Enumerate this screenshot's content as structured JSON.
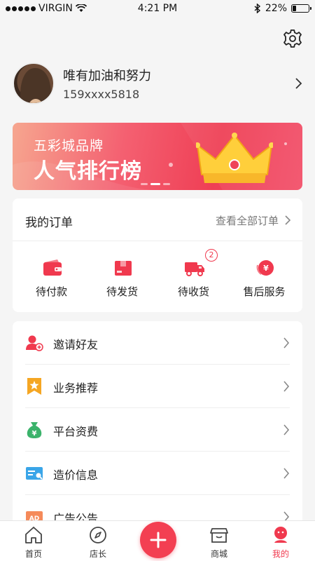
{
  "status_bar": {
    "carrier": "VIRGIN",
    "time": "4:21 PM",
    "battery": "22%",
    "battery_level": 0.22
  },
  "profile": {
    "name": "唯有加油和努力",
    "phone": "159xxxx5818"
  },
  "banner": {
    "subtitle": "五彩城品牌",
    "title": "人气排行榜"
  },
  "orders": {
    "title": "我的订单",
    "view_all": "查看全部订单",
    "items": [
      {
        "label": "待付款",
        "icon": "wallet-icon"
      },
      {
        "label": "待发货",
        "icon": "package-icon"
      },
      {
        "label": "待收货",
        "icon": "delivery-truck-icon",
        "badge": "2"
      },
      {
        "label": "售后服务",
        "icon": "refund-icon"
      }
    ]
  },
  "menu": [
    {
      "label": "邀请好友",
      "icon": "invite-user-icon"
    },
    {
      "label": "业务推荐",
      "icon": "star-bookmark-icon"
    },
    {
      "label": "平台资费",
      "icon": "money-bag-icon"
    },
    {
      "label": "造价信息",
      "icon": "price-card-icon"
    },
    {
      "label": "广告公告",
      "icon": "ad-icon"
    }
  ],
  "tabbar": {
    "tabs": [
      {
        "label": "首页",
        "icon": "home-icon"
      },
      {
        "label": "店长",
        "icon": "compass-icon"
      },
      {
        "label": "商城",
        "icon": "shop-icon"
      },
      {
        "label": "我的",
        "icon": "profile-icon"
      }
    ],
    "active": "我的",
    "fab_icon": "plus-icon"
  },
  "colors": {
    "accent": "#f0394e",
    "background": "#f5f5f5"
  }
}
